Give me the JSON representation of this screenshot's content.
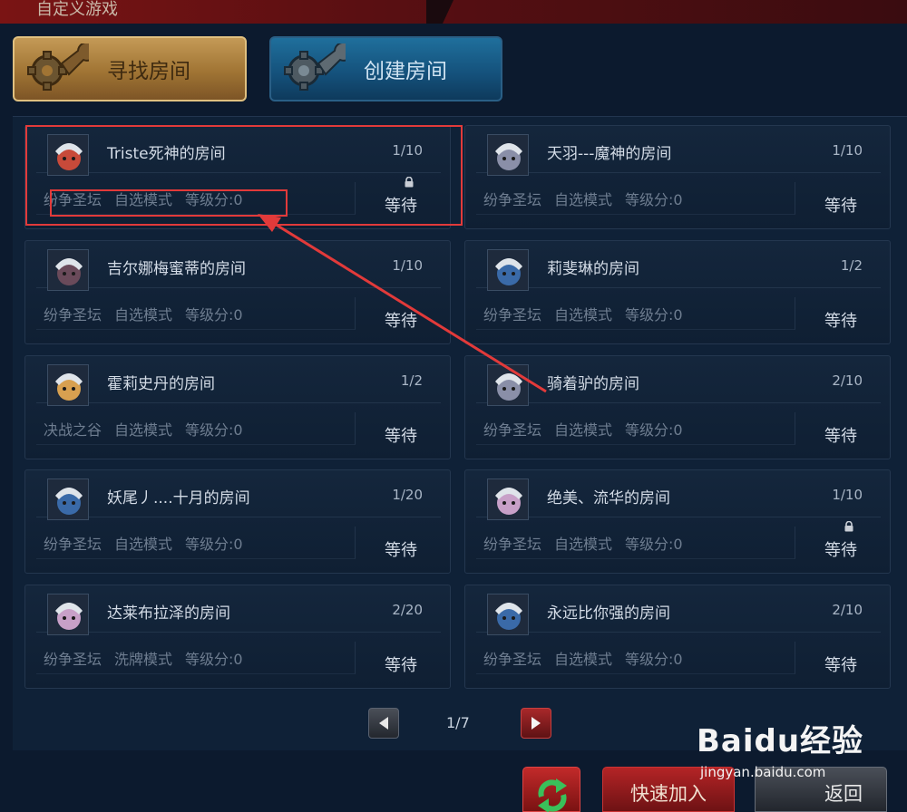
{
  "window": {
    "title": "自定义游戏"
  },
  "tabs": {
    "find": "寻找房间",
    "create": "创建房间"
  },
  "rooms": [
    {
      "name": "Triste死神的房间",
      "count": "1/10",
      "map": "纷争圣坛",
      "mode": "自选模式",
      "level": "等级分:0",
      "status": "等待",
      "locked": true,
      "avatar_color": "#c84a3a"
    },
    {
      "name": "天羽---魔神的房间",
      "count": "1/10",
      "map": "纷争圣坛",
      "mode": "自选模式",
      "level": "等级分:0",
      "status": "等待",
      "locked": false,
      "avatar_color": "#8a8fa8"
    },
    {
      "name": "吉尔娜梅蜜蒂的房间",
      "count": "1/10",
      "map": "纷争圣坛",
      "mode": "自选模式",
      "level": "等级分:0",
      "status": "等待",
      "locked": false,
      "avatar_color": "#6a4a5a"
    },
    {
      "name": "莉斐琳的房间",
      "count": "1/2",
      "map": "纷争圣坛",
      "mode": "自选模式",
      "level": "等级分:0",
      "status": "等待",
      "locked": false,
      "avatar_color": "#3a6aa8"
    },
    {
      "name": "霍莉史丹的房间",
      "count": "1/2",
      "map": "决战之谷",
      "mode": "自选模式",
      "level": "等级分:0",
      "status": "等待",
      "locked": false,
      "avatar_color": "#d8a050"
    },
    {
      "name": "骑着驴的房间",
      "count": "2/10",
      "map": "纷争圣坛",
      "mode": "自选模式",
      "level": "等级分:0",
      "status": "等待",
      "locked": false,
      "avatar_color": "#8a8fa8"
    },
    {
      "name": "妖尾丿....十月的房间",
      "count": "1/20",
      "map": "纷争圣坛",
      "mode": "自选模式",
      "level": "等级分:0",
      "status": "等待",
      "locked": false,
      "avatar_color": "#3a6aa8"
    },
    {
      "name": "绝美、流华的房间",
      "count": "1/10",
      "map": "纷争圣坛",
      "mode": "自选模式",
      "level": "等级分:0",
      "status": "等待",
      "locked": true,
      "avatar_color": "#c8a0c8"
    },
    {
      "name": "达莱布拉泽的房间",
      "count": "2/20",
      "map": "纷争圣坛",
      "mode": "洗牌模式",
      "level": "等级分:0",
      "status": "等待",
      "locked": false,
      "avatar_color": "#c8a0c8"
    },
    {
      "name": "永远比你强的房间",
      "count": "2/10",
      "map": "纷争圣坛",
      "mode": "自选模式",
      "level": "等级分:0",
      "status": "等待",
      "locked": false,
      "avatar_color": "#3a6aa8"
    }
  ],
  "pagination": {
    "page": "1/7"
  },
  "buttons": {
    "quick_join": "快速加入",
    "back": "返回"
  },
  "watermark": {
    "brand": "Baidu经验",
    "url": "jingyan.baidu.com"
  }
}
